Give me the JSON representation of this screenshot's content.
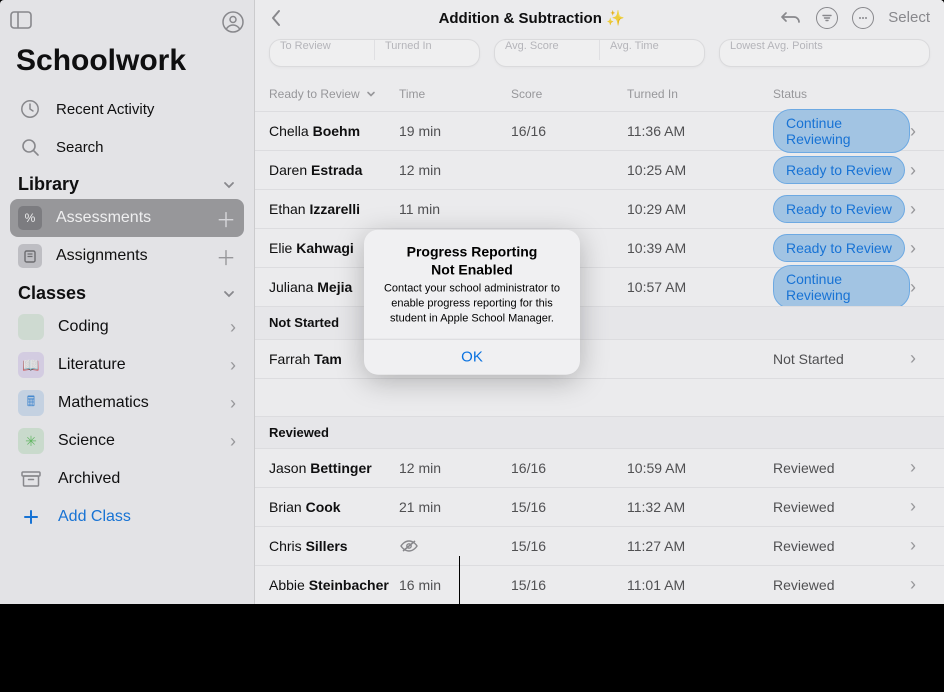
{
  "app": {
    "title": "Schoolwork"
  },
  "toolbar": {
    "title": "Addition & Subtraction ✨",
    "select": "Select"
  },
  "sidebar": {
    "recent": "Recent Activity",
    "search": "Search",
    "library_header": "Library",
    "library": [
      {
        "label": "Assessments",
        "selected": true
      },
      {
        "label": "Assignments",
        "selected": false
      }
    ],
    "classes_header": "Classes",
    "classes": [
      {
        "label": "Coding",
        "color": "#7dc17b",
        "glyph": "</>"
      },
      {
        "label": "Literature",
        "color": "#9a72d8",
        "glyph": "📖"
      },
      {
        "label": "Mathematics",
        "color": "#3f8bd9",
        "glyph": "🖩"
      },
      {
        "label": "Science",
        "color": "#5fbf5f",
        "glyph": "✳"
      }
    ],
    "archived": "Archived",
    "add_class": "Add Class"
  },
  "summary": {
    "card1": [
      "To Review",
      "Turned In"
    ],
    "card2": [
      "Avg. Score",
      "Avg. Time"
    ],
    "card3": [
      "Lowest Avg. Points"
    ]
  },
  "columns": {
    "ready": "Ready to Review",
    "time": "Time",
    "score": "Score",
    "turned": "Turned In",
    "status": "Status"
  },
  "sections": {
    "not_started": "Not Started",
    "reviewed": "Reviewed"
  },
  "status_labels": {
    "continue": "Continue Reviewing",
    "ready": "Ready to Review",
    "not_started": "Not Started",
    "reviewed": "Reviewed"
  },
  "rows_ready": [
    {
      "first": "Chella",
      "last": "Boehm",
      "time": "19 min",
      "score": "16/16",
      "turned": "11:36 AM",
      "status": "continue"
    },
    {
      "first": "Daren",
      "last": "Estrada",
      "time": "12 min",
      "score": "",
      "turned": "10:25 AM",
      "status": "ready"
    },
    {
      "first": "Ethan",
      "last": "Izzarelli",
      "time": "11 min",
      "score": "",
      "turned": "10:29 AM",
      "status": "ready"
    },
    {
      "first": "Elie",
      "last": "Kahwagi",
      "time": "",
      "score": "",
      "turned": "10:39 AM",
      "status": "ready"
    },
    {
      "first": "Juliana",
      "last": "Mejia",
      "time": "",
      "score": "",
      "turned": "10:57 AM",
      "status": "continue"
    }
  ],
  "rows_notstarted": [
    {
      "first": "Farrah",
      "last": "Tam",
      "time": "",
      "score": "",
      "turned": "",
      "status": "not_started"
    }
  ],
  "rows_reviewed": [
    {
      "first": "Jason",
      "last": "Bettinger",
      "time": "12 min",
      "score": "16/16",
      "turned": "10:59 AM",
      "status": "reviewed"
    },
    {
      "first": "Brian",
      "last": "Cook",
      "time": "21 min",
      "score": "15/16",
      "turned": "11:32 AM",
      "status": "reviewed"
    },
    {
      "first": "Chris",
      "last": "Sillers",
      "time": "",
      "eye_off": true,
      "score": "15/16",
      "turned": "11:27 AM",
      "status": "reviewed"
    },
    {
      "first": "Abbie",
      "last": "Steinbacher",
      "time": "16 min",
      "score": "15/16",
      "turned": "11:01 AM",
      "status": "reviewed"
    }
  ],
  "dialog": {
    "title1": "Progress Reporting",
    "title2": "Not Enabled",
    "message": "Contact your school administrator to enable progress reporting for this student in Apple School Manager.",
    "ok": "OK"
  }
}
